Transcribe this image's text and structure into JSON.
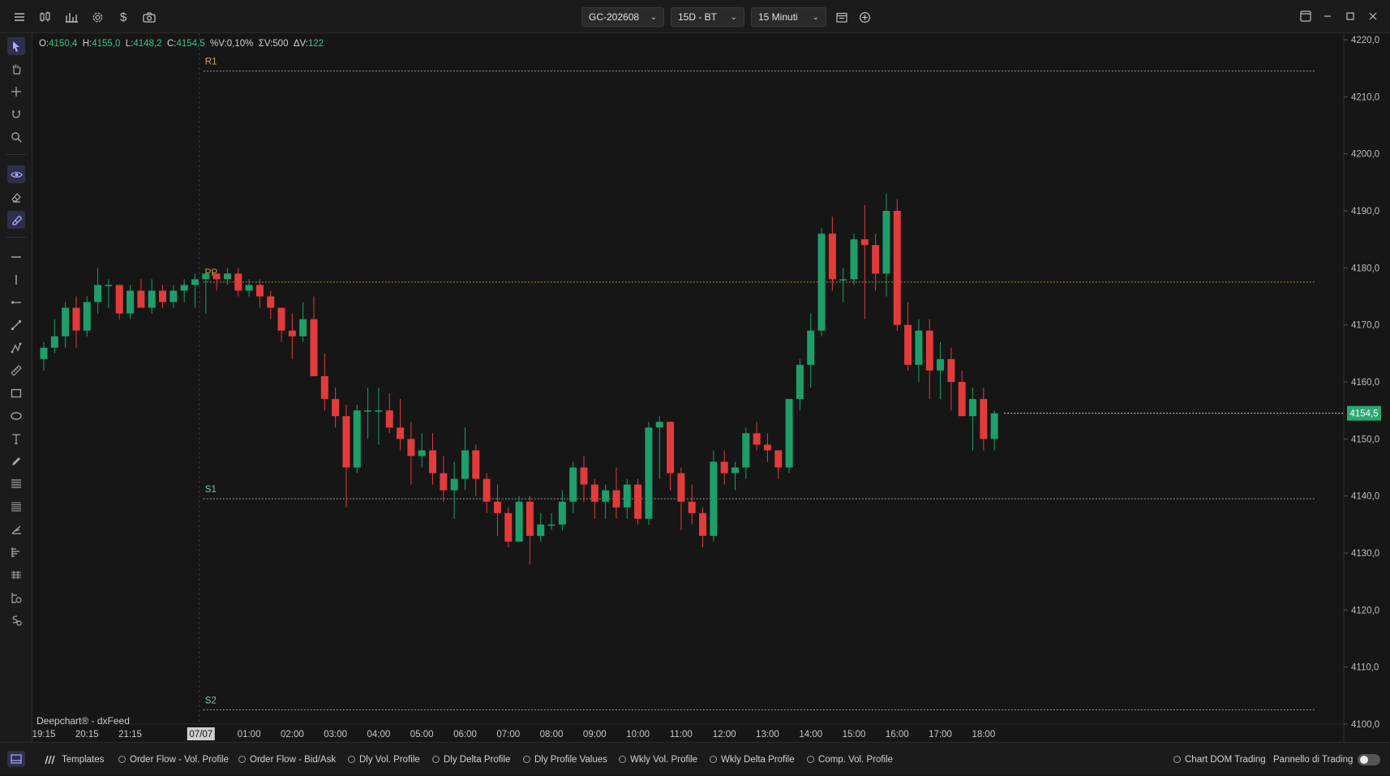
{
  "toolbar": {
    "symbol": "GC-202608",
    "range": "15D - BT",
    "timeframe": "15 Minuti",
    "icons": [
      "menu-icon",
      "candles-icon",
      "bars-icon",
      "gear-icon",
      "dollar-icon",
      "camera-icon"
    ]
  },
  "ohlc": {
    "o_label": "O:",
    "o": "4150,4",
    "h_label": "H:",
    "h": "4155,0",
    "l_label": "L:",
    "l": "4148,2",
    "c_label": "C:",
    "c": "4154,5",
    "pv_label": "%V:",
    "pv": "0,10%",
    "sv_label": "ΣV:",
    "sv": "500",
    "dv_label": "ΔV:",
    "dv": "122"
  },
  "watermark": "Deepchart® - dxFeed",
  "colors": {
    "bull": "#1e9e6a",
    "bear": "#e23b3b",
    "bg": "#161616",
    "pivot": "#c8a040",
    "support": "#b0b0b0",
    "price_tag": "#2aa873"
  },
  "chart_data": {
    "type": "candlestick",
    "y_ticks": [
      "4100,0",
      "4110,0",
      "4120,0",
      "4130,0",
      "4140,0",
      "4150,0",
      "4160,0",
      "4170,0",
      "4180,0",
      "4190,0",
      "4200,0",
      "4210,0",
      "4220,0"
    ],
    "ylim": [
      4100,
      4220
    ],
    "x_labels": [
      "19:15",
      "20:15",
      "21:15",
      "07/07",
      "01:00",
      "02:00",
      "03:00",
      "04:00",
      "05:00",
      "06:00",
      "07:00",
      "08:00",
      "09:00",
      "10:00",
      "11:00",
      "12:00",
      "13:00",
      "14:00",
      "15:00",
      "16:00",
      "17:00",
      "18:00"
    ],
    "x_label_bars": [
      0,
      4,
      8,
      15,
      19,
      23,
      27,
      31,
      35,
      39,
      43,
      47,
      51,
      55,
      59,
      63,
      67,
      71,
      75,
      79,
      83,
      87
    ],
    "session_divider_bar": 15,
    "last_price": "4154,5",
    "last_price_value": 4154.5,
    "levels": [
      {
        "label": "R1",
        "value": 4214.5,
        "kind": "r"
      },
      {
        "label": "PP",
        "value": 4177.5,
        "kind": "pp"
      },
      {
        "label": "S1",
        "value": 4139.5,
        "kind": "s"
      },
      {
        "label": "S2",
        "value": 4102.5,
        "kind": "s"
      }
    ],
    "candles": [
      [
        4164,
        4167,
        4162,
        4166
      ],
      [
        4166,
        4171,
        4165,
        4168
      ],
      [
        4168,
        4174,
        4166,
        4173
      ],
      [
        4173,
        4175,
        4166,
        4169
      ],
      [
        4169,
        4175,
        4168,
        4174
      ],
      [
        4174,
        4180,
        4172,
        4177
      ],
      [
        4177,
        4178,
        4173,
        4177
      ],
      [
        4177,
        4177,
        4171,
        4172
      ],
      [
        4172,
        4177,
        4171,
        4176
      ],
      [
        4176,
        4178,
        4174,
        4173
      ],
      [
        4173,
        4178,
        4172,
        4176
      ],
      [
        4176,
        4177,
        4173,
        4174
      ],
      [
        4174,
        4177,
        4173,
        4176
      ],
      [
        4176,
        4178,
        4174,
        4177
      ],
      [
        4177,
        4179,
        4173,
        4178
      ],
      [
        4178,
        4180,
        4172,
        4179
      ],
      [
        4179,
        4179,
        4176,
        4178
      ],
      [
        4178,
        4180,
        4177,
        4179
      ],
      [
        4179,
        4180,
        4175,
        4176
      ],
      [
        4176,
        4178,
        4175,
        4177
      ],
      [
        4177,
        4178,
        4173,
        4175
      ],
      [
        4175,
        4176,
        4171,
        4173
      ],
      [
        4173,
        4173,
        4167,
        4169
      ],
      [
        4169,
        4172,
        4164,
        4168
      ],
      [
        4168,
        4174,
        4167,
        4171
      ],
      [
        4171,
        4175,
        4161,
        4161
      ],
      [
        4161,
        4165,
        4155,
        4157
      ],
      [
        4157,
        4159,
        4152,
        4154
      ],
      [
        4154,
        4156,
        4138,
        4145
      ],
      [
        4145,
        4156,
        4144,
        4155
      ],
      [
        4155,
        4159,
        4150,
        4155
      ],
      [
        4155,
        4159,
        4149,
        4155
      ],
      [
        4155,
        4158,
        4151,
        4152
      ],
      [
        4152,
        4157,
        4148,
        4150
      ],
      [
        4150,
        4153,
        4142,
        4147
      ],
      [
        4147,
        4151,
        4145,
        4148
      ],
      [
        4148,
        4151,
        4142,
        4144
      ],
      [
        4144,
        4147,
        4139,
        4141
      ],
      [
        4141,
        4146,
        4136,
        4143
      ],
      [
        4143,
        4152,
        4141,
        4148
      ],
      [
        4148,
        4149,
        4140,
        4143
      ],
      [
        4143,
        4144,
        4137,
        4139
      ],
      [
        4139,
        4142,
        4133,
        4137
      ],
      [
        4137,
        4138,
        4131,
        4132
      ],
      [
        4132,
        4140,
        4132,
        4139
      ],
      [
        4139,
        4140,
        4128,
        4133
      ],
      [
        4133,
        4137,
        4132,
        4135
      ],
      [
        4135,
        4137,
        4134,
        4135
      ],
      [
        4135,
        4141,
        4134,
        4139
      ],
      [
        4139,
        4146,
        4137,
        4145
      ],
      [
        4145,
        4147,
        4139,
        4142
      ],
      [
        4142,
        4143,
        4136,
        4139
      ],
      [
        4139,
        4142,
        4136,
        4141
      ],
      [
        4141,
        4145,
        4136,
        4138
      ],
      [
        4138,
        4143,
        4136,
        4142
      ],
      [
        4142,
        4143,
        4135,
        4136
      ],
      [
        4136,
        4153,
        4135,
        4152
      ],
      [
        4152,
        4154,
        4143,
        4153
      ],
      [
        4153,
        4153,
        4141,
        4144
      ],
      [
        4144,
        4145,
        4134,
        4139
      ],
      [
        4139,
        4142,
        4135,
        4137
      ],
      [
        4137,
        4138,
        4131,
        4133
      ],
      [
        4133,
        4148,
        4132,
        4146
      ],
      [
        4146,
        4148,
        4142,
        4144
      ],
      [
        4144,
        4146,
        4141,
        4145
      ],
      [
        4145,
        4152,
        4143,
        4151
      ],
      [
        4151,
        4153,
        4148,
        4149
      ],
      [
        4149,
        4151,
        4146,
        4148
      ],
      [
        4148,
        4148,
        4143,
        4145
      ],
      [
        4145,
        4157,
        4144,
        4157
      ],
      [
        4157,
        4164,
        4155,
        4163
      ],
      [
        4163,
        4172,
        4159,
        4169
      ],
      [
        4169,
        4187,
        4168,
        4186
      ],
      [
        4186,
        4189,
        4176,
        4178
      ],
      [
        4178,
        4180,
        4174,
        4178
      ],
      [
        4178,
        4186,
        4177,
        4185
      ],
      [
        4185,
        4191,
        4171,
        4184
      ],
      [
        4184,
        4186,
        4176,
        4179
      ],
      [
        4179,
        4193,
        4175,
        4190
      ],
      [
        4190,
        4192,
        4169,
        4170
      ],
      [
        4170,
        4174,
        4162,
        4163
      ],
      [
        4163,
        4171,
        4160,
        4169
      ],
      [
        4169,
        4171,
        4157,
        4162
      ],
      [
        4162,
        4167,
        4157,
        4164
      ],
      [
        4164,
        4166,
        4155,
        4160
      ],
      [
        4160,
        4162,
        4155,
        4154
      ],
      [
        4154,
        4159,
        4148,
        4157
      ],
      [
        4157,
        4159,
        4148,
        4150
      ],
      [
        4150,
        4155,
        4148,
        4154.5
      ]
    ]
  },
  "left_tools": [
    "cursor-icon",
    "hand-icon",
    "crosshair-icon",
    "magnet-icon",
    "zoom-icon",
    "eye-icon",
    "eraser-icon",
    "magnet-lock-icon",
    "horizontal-line-icon",
    "vertical-line-icon",
    "ray-icon",
    "trendline-icon",
    "polyline-icon",
    "ruler-icon",
    "rectangle-icon",
    "ellipse-icon",
    "text-icon",
    "pencil-icon",
    "fib-icon",
    "fib-ext-icon",
    "pitchfork-icon",
    "volume-profile-icon",
    "gann-icon",
    "position-icon",
    "short-position-icon"
  ],
  "templates": {
    "label": "Templates",
    "items": [
      "Order Flow - Vol. Profile",
      "Order Flow - Bid/Ask",
      "Dly Vol. Profile",
      "Dly Delta Profile",
      "Dly Profile Values",
      "Wkly Vol. Profile",
      "Wkly Delta Profile",
      "Comp. Vol. Profile"
    ],
    "chart_dom": "Chart DOM Trading",
    "panel": "Pannello di Trading"
  }
}
